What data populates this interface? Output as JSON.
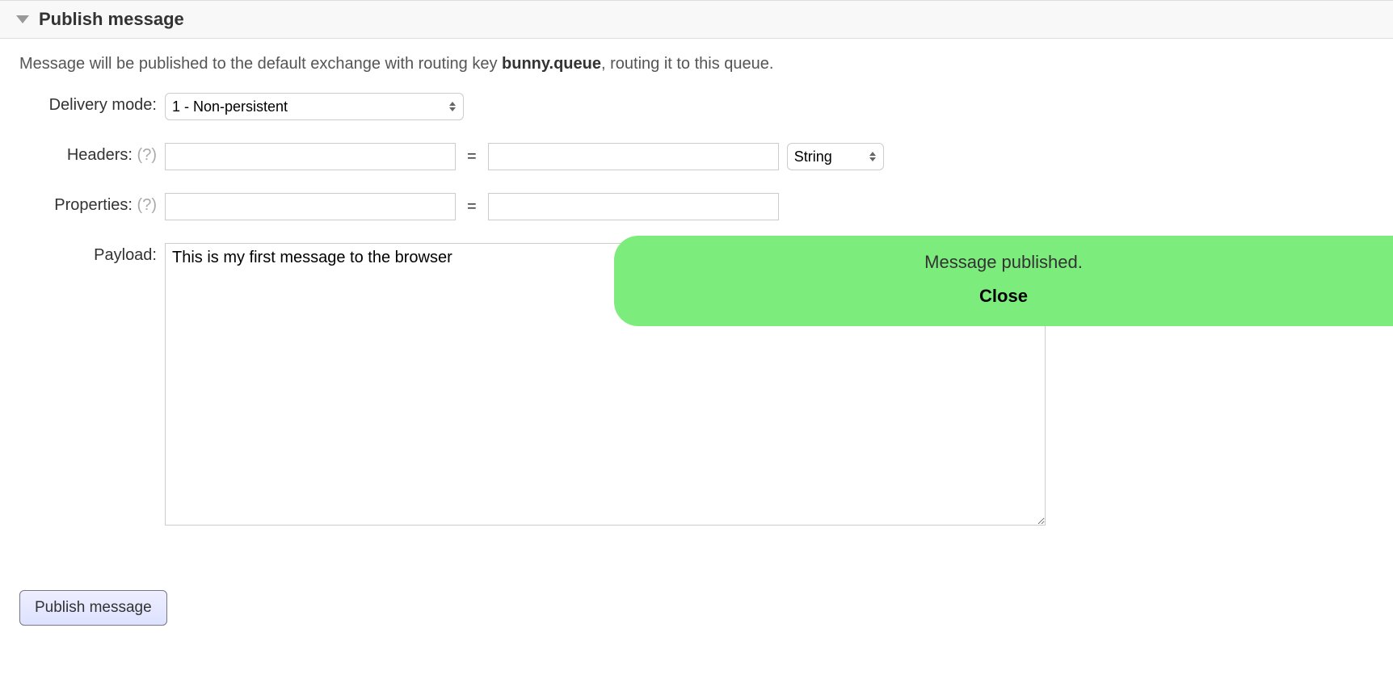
{
  "section": {
    "title": "Publish message"
  },
  "description": {
    "prefix": "Message will be published to the default exchange with routing key ",
    "routing_key": "bunny.queue",
    "suffix": ", routing it to this queue."
  },
  "form": {
    "delivery_mode": {
      "label": "Delivery mode:",
      "selected": "1 - Non-persistent"
    },
    "headers": {
      "label": "Headers:",
      "hint": "(?)",
      "key": "",
      "value": "",
      "type_selected": "String"
    },
    "properties": {
      "label": "Properties:",
      "hint": "(?)",
      "key": "",
      "value": ""
    },
    "payload": {
      "label": "Payload:",
      "value_prefix": "This is my first message to the ",
      "value_spell": "browser"
    },
    "submit_label": "Publish message"
  },
  "notification": {
    "message": "Message published.",
    "close_label": "Close"
  }
}
